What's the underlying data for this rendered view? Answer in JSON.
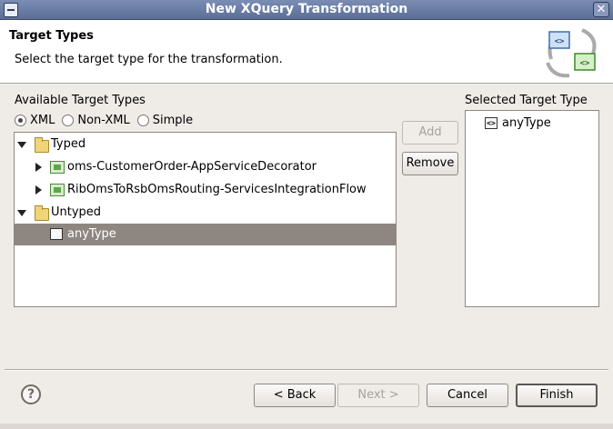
{
  "window": {
    "title": "New XQuery Transformation"
  },
  "header": {
    "title": "Target Types",
    "description": "Select the target type for the transformation."
  },
  "available": {
    "label": "Available Target Types",
    "radios": [
      {
        "label": "XML",
        "checked": true
      },
      {
        "label": "Non-XML",
        "checked": false
      },
      {
        "label": "Simple",
        "checked": false
      }
    ],
    "tree": {
      "typed_label": "Typed",
      "typed_items": [
        "oms-CustomerOrder-AppServiceDecorator",
        "RibOmsToRsbOmsRouting-ServicesIntegrationFlow"
      ],
      "untyped_label": "Untyped",
      "untyped_item": "anyType"
    }
  },
  "buttons": {
    "add": "Add",
    "remove": "Remove",
    "back": "< Back",
    "next": "Next >",
    "cancel": "Cancel",
    "finish": "Finish"
  },
  "selected": {
    "label": "Selected Target Type",
    "item": "anyType"
  },
  "icons": {
    "close": "close-icon",
    "help": "help-icon",
    "banner": "xquery-transformation-icon",
    "type_glyph": "<>"
  },
  "colors": {
    "titlebar": "#5b6e97",
    "selection": "#8e8680",
    "background": "#efebe7"
  }
}
